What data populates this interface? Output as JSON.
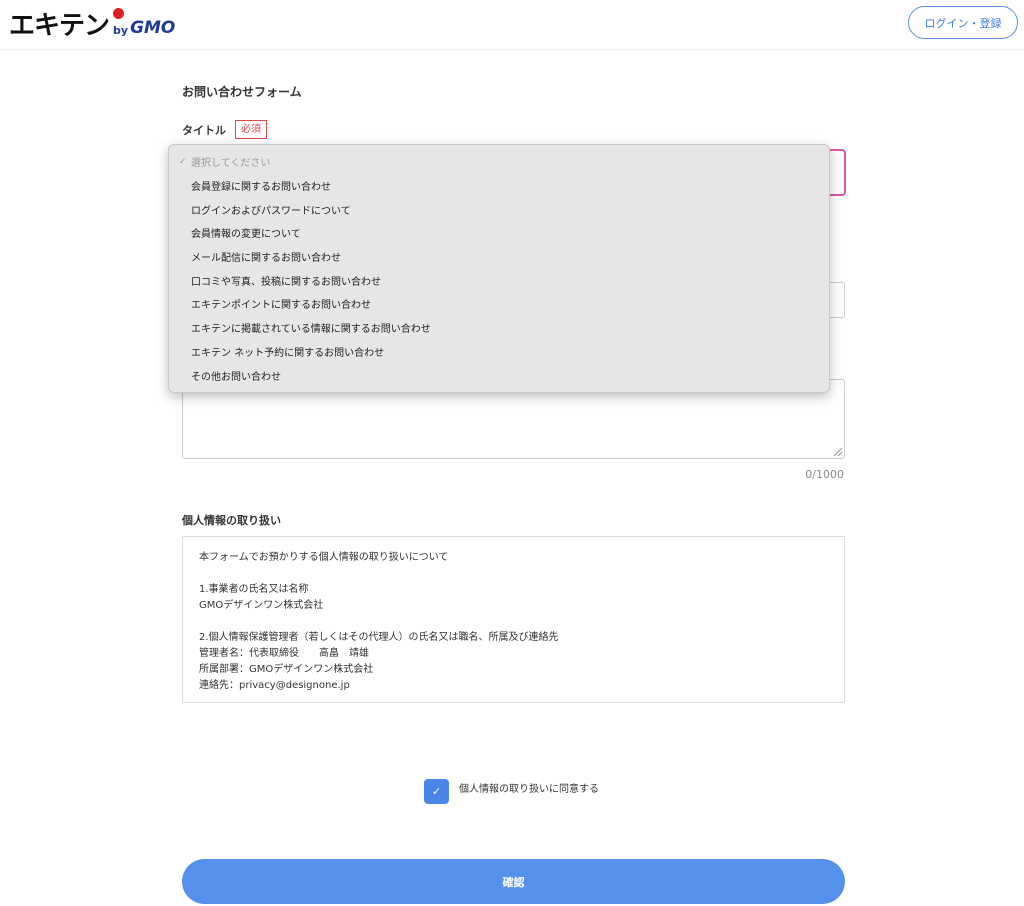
{
  "header": {
    "logo_main": "エキテン",
    "logo_by": "by",
    "logo_gmo": "GMO",
    "login_button": "ログイン・登録"
  },
  "form": {
    "title": "お問い合わせフォーム",
    "title_field_label": "タイトル",
    "required_badge": "必須",
    "char_count": "0/1000"
  },
  "dropdown": {
    "placeholder": "選択してください",
    "options": [
      "会員登録に関するお問い合わせ",
      "ログインおよびパスワードについて",
      "会員情報の変更について",
      "メール配信に関するお問い合わせ",
      "口コミや写真、投稿に関するお問い合わせ",
      "エキテンポイントに関するお問い合わせ",
      "エキテンに掲載されている情報に関するお問い合わせ",
      "エキテン ネット予約に関するお問い合わせ",
      "その他お問い合わせ"
    ]
  },
  "privacy": {
    "title": "個人情報の取り扱い",
    "text": "本フォームでお預かりする個人情報の取り扱いについて\n\n1.事業者の氏名又は名称\nGMOデザインワン株式会社\n\n2.個人情報保護管理者（若しくはその代理人）の氏名又は職名、所属及び連絡先\n管理者名：代表取締役　　高畠　靖雄\n所属部署：GMOデザインワン株式会社\n連絡先：privacy@designone.jp",
    "agree_label": "個人情報の取り扱いに同意する",
    "agree_checked": true
  },
  "confirm_button": "確認",
  "colors": {
    "accent": "#5591ec",
    "required": "#e04848",
    "select_focus": "#d85aa8",
    "logo_dot": "#e02020"
  }
}
